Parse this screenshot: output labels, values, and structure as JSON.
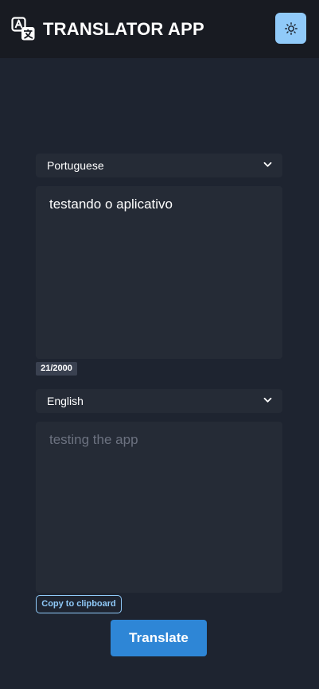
{
  "header": {
    "title": "TRANSLATOR APP",
    "logo_icon": "translate-icon",
    "theme_toggle_icon": "sun-icon",
    "accent_color": "#90caf9"
  },
  "source": {
    "language": "Portuguese",
    "text": "testando o aplicativo",
    "char_count": "21/2000"
  },
  "target": {
    "language": "English",
    "text": "testing the app"
  },
  "actions": {
    "copy_label": "Copy to clipboard",
    "translate_label": "Translate",
    "translate_color": "#2e86d6"
  }
}
